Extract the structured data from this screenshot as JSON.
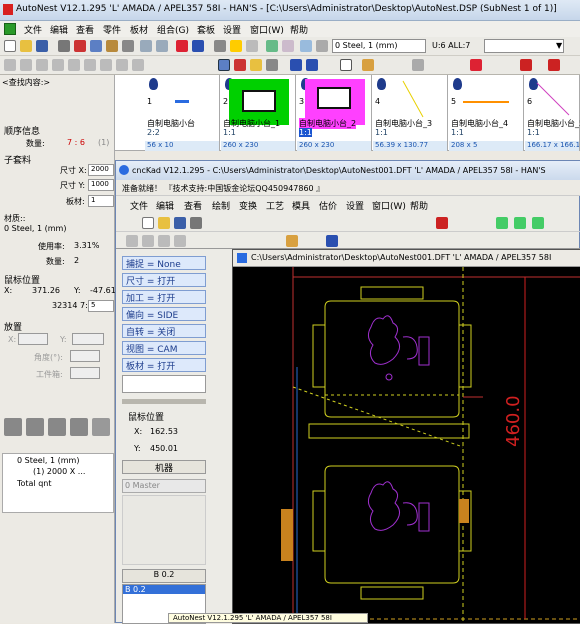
{
  "app": {
    "title": "AutoNest V12.1.295  'L'  AMADA / APEL357   58I     - HAN'S - [C:\\Users\\Administrator\\Desktop\\AutoNest.DSP (SubNest 1 of 1)]"
  },
  "menu": [
    "文件",
    "编辑",
    "查看",
    "零件",
    "板材",
    "组合(G)",
    "套板",
    "设置",
    "窗口(W)",
    "帮助"
  ],
  "toolbar": {
    "material_select": "0  Steel, 1 (mm)",
    "ui_label": "U:6 ALL:7"
  },
  "left_panel": {
    "search_label": "<查找内容:>",
    "order_info": "顺序信息",
    "quantity_label": "数量:",
    "quantity_value": "7 : 6",
    "quantity_extra": "(1)",
    "sub_sheet": "子套料",
    "size_x_label": "尺寸 X:",
    "size_x_value": "2000",
    "size_y_label": "尺寸 Y:",
    "size_y_value": "1000",
    "sheet_label": "板材:",
    "sheet_value": "1",
    "material_label": "材质::",
    "material_value": "0 Steel, 1 (mm)",
    "usage_label": "使用率:",
    "usage_value": "3.31%",
    "count_label": "数量:",
    "count_value": "2",
    "mouse_pos": "鼠标位置",
    "x_label": "X:",
    "x_value": "371.26",
    "y_label": "Y:",
    "y_value": "-47.61",
    "extra_value": "32314 7:",
    "extra_input": "5",
    "place": "放置",
    "place_x": "X:",
    "place_y": "Y:",
    "angle": "角度(°):",
    "workbox": "工件箱:",
    "tree_items": [
      "0  Steel, 1 (mm)",
      "(1) 2000 X ...",
      "Total qnt"
    ]
  },
  "parts": [
    {
      "num": "1",
      "name": "自制电脑小台",
      "qty": "2:2",
      "size": "56 x 10",
      "color": "#2a6be0"
    },
    {
      "num": "2",
      "name": "自制电脑小台_1",
      "qty": "1:1",
      "size": "260 x 230",
      "color": "#00d000"
    },
    {
      "num": "3",
      "name": "自制电脑小台_2",
      "qty": "1:1",
      "size": "260 x 230",
      "color": "#ff40ff"
    },
    {
      "num": "4",
      "name": "自制电脑小台_3",
      "qty": "1:1",
      "size": "56.39 x 130.77",
      "color": "#e8d000"
    },
    {
      "num": "5",
      "name": "自制电脑小台_4",
      "qty": "1:1",
      "size": "208 x 5",
      "color": "#ff9000"
    },
    {
      "num": "6",
      "name": "自制电脑小台_5",
      "qty": "1:1",
      "size": "166.17 x 166.1",
      "color": "#d040c0"
    }
  ],
  "cnc": {
    "title": "cncKad V12.1.295  - C:\\Users\\Administrator\\Desktop\\AutoNest001.DFT  'L'  AMADA / APEL357   58I     - HAN'S",
    "status": "准备就绪！  『技术支持:中国钣金论坛QQ450947860 』",
    "menu": [
      "文件",
      "编辑",
      "查看",
      "绘制",
      "变换",
      "工艺",
      "模具",
      "估价",
      "设置",
      "窗口(W)",
      "帮助"
    ],
    "commands": [
      "捕捉 = None",
      "尺寸 = 打开",
      "加工 = 打开",
      "偏向 = SIDE",
      "自转 = 关闭",
      "视图 = CAM",
      "板材 = 打开"
    ],
    "mouse_pos": "鼠标位置",
    "x_label": "X:",
    "x_value": "162.53",
    "y_label": "Y:",
    "y_value": "450.01",
    "machine": "机器",
    "master": "0 Master",
    "b_label": "B 0.2",
    "b_selected": "B 0.2",
    "inner_title": "C:\\Users\\Administrator\\Desktop\\AutoNest001.DFT  'L'  AMADA / APEL357   58I",
    "dimension": "460.0"
  },
  "taskbar_hint": "AutoNest V12.1.295  'L'  AMADA / APEL357   58I"
}
